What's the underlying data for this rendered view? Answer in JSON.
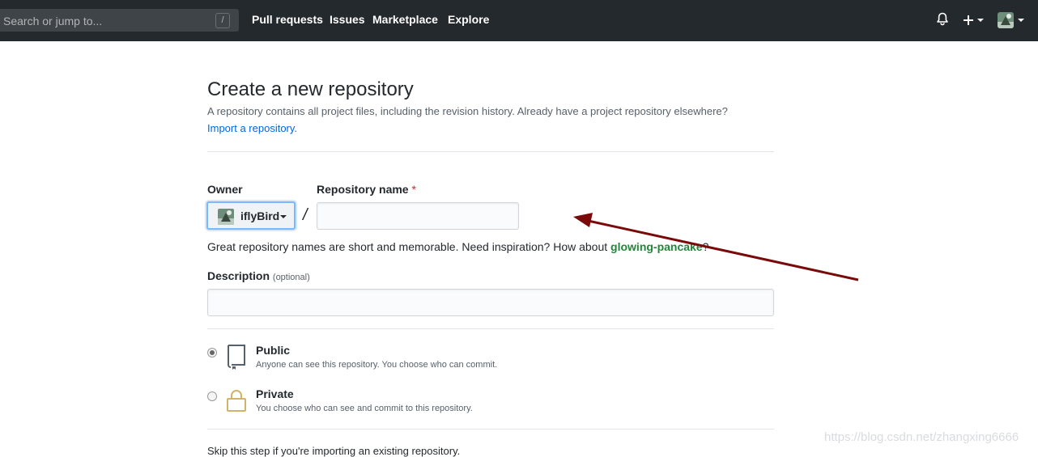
{
  "header": {
    "search_placeholder": "Search or jump to...",
    "search_shortcut": "/",
    "nav": [
      "Pull requests",
      "Issues",
      "Marketplace",
      "Explore"
    ],
    "icons": [
      "bell-icon",
      "plus-icon",
      "avatar"
    ]
  },
  "page": {
    "title": "Create a new repository",
    "subtitle": "A repository contains all project files, including the revision history. Already have a project repository elsewhere?",
    "import_link": "Import a repository."
  },
  "form": {
    "owner_label": "Owner",
    "owner_value": "iflyBird",
    "separator": "/",
    "repo_name_label": "Repository name",
    "required_mark": "*",
    "repo_name_value": "",
    "hint_text": "Great repository names are short and memorable. Need inspiration? How about ",
    "hint_suggestion": "glowing-pancake",
    "hint_end": "?",
    "description_label": "Description",
    "description_optional": "(optional)",
    "description_value": ""
  },
  "visibility": {
    "selected": "public",
    "options": [
      {
        "title": "Public",
        "desc": "Anyone can see this repository. You choose who can commit.",
        "icon": "repo-icon"
      },
      {
        "title": "Private",
        "desc": "You choose who can see and commit to this repository.",
        "icon": "lock-icon"
      }
    ]
  },
  "footer": {
    "partial_text": "Skip this step if you're importing an existing repository."
  },
  "watermark": "https://blog.csdn.net/zhangxing6666",
  "colors": {
    "header_bg": "#24292e",
    "link": "#0366d6",
    "suggestion": "#22863a",
    "arrow": "#7a0a0a"
  }
}
